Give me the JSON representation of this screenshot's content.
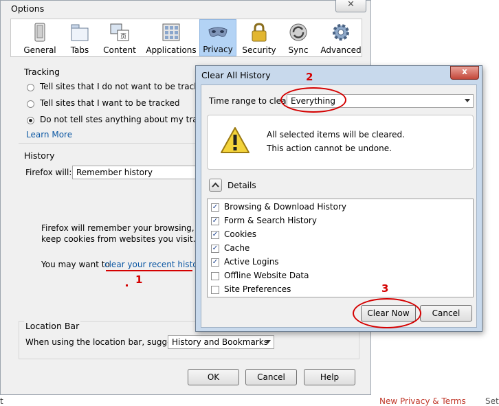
{
  "options": {
    "title": "Options",
    "close_glyph": "✕",
    "tabs": [
      {
        "label": "General",
        "icon": "general-icon"
      },
      {
        "label": "Tabs",
        "icon": "tabs-icon"
      },
      {
        "label": "Content",
        "icon": "content-icon"
      },
      {
        "label": "Applications",
        "icon": "applications-icon"
      },
      {
        "label": "Privacy",
        "icon": "privacy-mask-icon"
      },
      {
        "label": "Security",
        "icon": "padlock-icon"
      },
      {
        "label": "Sync",
        "icon": "sync-icon"
      },
      {
        "label": "Advanced",
        "icon": "gear-icon"
      }
    ],
    "tracking": {
      "label": "Tracking",
      "options": [
        "Tell sites that I do not want to be tracked",
        "Tell sites that I want to be tracked",
        "Do not tell stes anything about my tracking"
      ],
      "learn_more": "Learn More"
    },
    "history": {
      "label": "History",
      "firefox_will": "Firefox will:",
      "selected": "Remember history",
      "desc_line1": "Firefox will remember your browsing, down",
      "desc_line2": "keep cookies from websites you visit.",
      "may_want": "You may want to",
      "clear_link": "clear your recent history,"
    },
    "location_bar": {
      "label": "Location Bar",
      "suggest_label": "When using the location bar, suggest:",
      "selected": "History and Bookmarks"
    },
    "buttons": {
      "ok": "OK",
      "cancel": "Cancel",
      "help": "Help"
    }
  },
  "dialog": {
    "title": "Clear All History",
    "close_glyph": "x",
    "time_range_label": "Time range to clear:",
    "time_range_value": "Everything",
    "warning_line1": "All selected items will be cleared.",
    "warning_line2": "This action cannot be undone.",
    "details_label": "Details",
    "items": [
      {
        "label": "Browsing & Download History",
        "checked": true
      },
      {
        "label": "Form & Search History",
        "checked": true
      },
      {
        "label": "Cookies",
        "checked": true
      },
      {
        "label": "Cache",
        "checked": true
      },
      {
        "label": "Active Logins",
        "checked": true
      },
      {
        "label": "Offline Website Data",
        "checked": false
      },
      {
        "label": "Site Preferences",
        "checked": false
      }
    ],
    "buttons": {
      "clear_now": "Clear Now",
      "cancel": "Cancel"
    }
  },
  "annotations": {
    "one": "1",
    "two": "2",
    "three": "3"
  },
  "background_fragments": {
    "left": "t",
    "mid": "New Privacy & Terms",
    "right": "Set"
  },
  "colors": {
    "annotation_red": "#d40000",
    "link_blue": "#0b57a3",
    "privacy_tab_bg": "#b3d3f5"
  }
}
